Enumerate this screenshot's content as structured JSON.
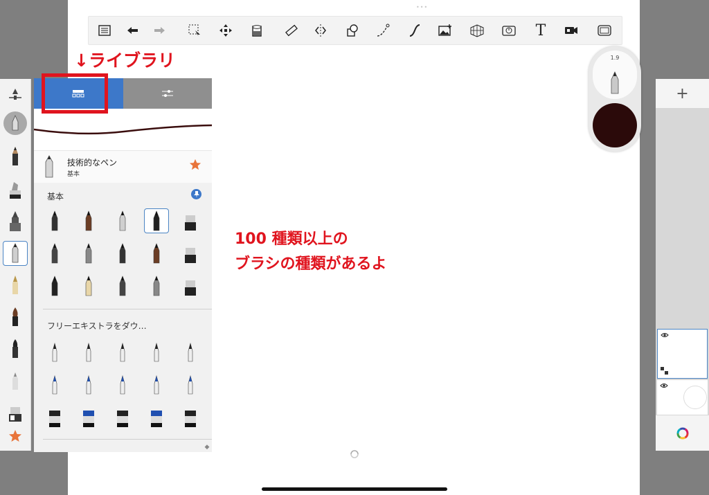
{
  "annotations": {
    "library_label": "↓ライブラリ",
    "line1": "100 種類以上の",
    "line2": "ブラシの種類があるよ"
  },
  "toolbar": {
    "handle": "•••",
    "items": [
      "list-icon",
      "undo-icon",
      "redo-icon",
      "selection-icon",
      "transform-icon",
      "fill-icon",
      "ruler-icon",
      "symmetry-icon",
      "shapes-icon",
      "curve-icon",
      "stroke-icon",
      "image-icon",
      "perspective-icon",
      "time-lapse-icon",
      "text-icon",
      "video-icon",
      "fullscreen-icon"
    ],
    "text_tool": "T"
  },
  "brush_library": {
    "current_brush": {
      "name": "技術的なペン",
      "category": "基本"
    },
    "section_basic": "基本",
    "section_free": "フリーエキストラをダウ…",
    "selected_index": 3
  },
  "puck": {
    "size": "1.9",
    "color": "#2b0a0a"
  },
  "layers": {
    "add": "+"
  },
  "colors": {
    "accent": "#3d78c9",
    "annotation_red": "#e0141e",
    "star": "#e8743a"
  }
}
